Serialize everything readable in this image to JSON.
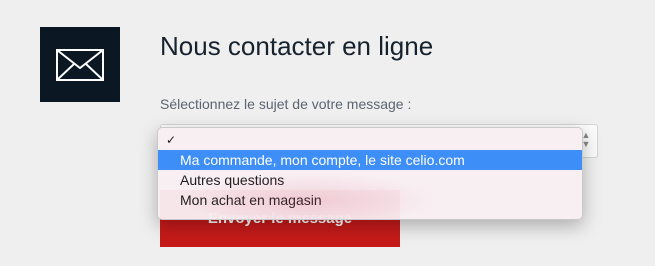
{
  "page": {
    "title": "Nous contacter en ligne",
    "subject_label": "Sélectionnez le sujet de votre message :"
  },
  "form": {
    "subject_select_value": "",
    "submit_label": "Envoyer le message"
  },
  "dropdown": {
    "options": [
      {
        "label": "",
        "selected": true
      },
      {
        "label": "Ma commande, mon compte, le site celio.com",
        "highlighted": true
      },
      {
        "label": "Autres questions"
      },
      {
        "label": "Mon achat en magasin"
      }
    ],
    "check_mark": "✓"
  },
  "icons": {
    "contact": "envelope-icon",
    "select_arrow": "updown-arrows-icon"
  },
  "colors": {
    "icon_bg": "#0b1722",
    "button_bg": "#c61a1a",
    "highlight": "#3d8ef7",
    "page_bg": "#efefef"
  }
}
